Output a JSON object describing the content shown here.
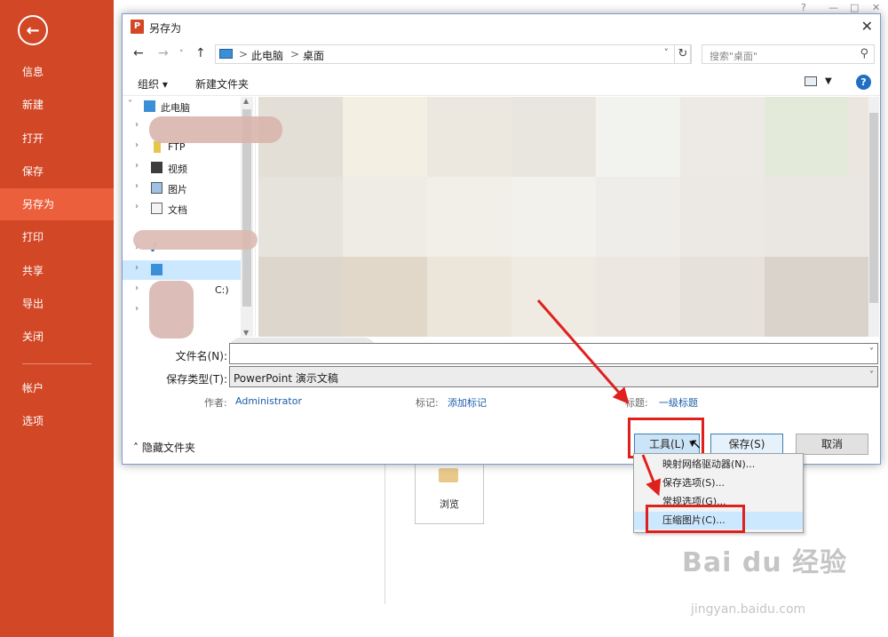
{
  "backstage": {
    "items": [
      {
        "label": "信息"
      },
      {
        "label": "新建"
      },
      {
        "label": "打开"
      },
      {
        "label": "保存"
      },
      {
        "label": "另存为"
      },
      {
        "label": "打印"
      },
      {
        "label": "共享"
      },
      {
        "label": "导出"
      },
      {
        "label": "关闭"
      },
      {
        "label": "帐户"
      },
      {
        "label": "选项"
      }
    ],
    "active_item": "另存为",
    "accent_color": "#d24726"
  },
  "background": {
    "browse_label": "浏览",
    "window_controls": [
      "?",
      "—",
      "□",
      "✕"
    ]
  },
  "dialog": {
    "title": "另存为",
    "close_glyph": "✕",
    "breadcrumb": [
      "此电脑",
      "桌面"
    ],
    "breadcrumb_sep": ">",
    "search_placeholder": "搜索\"桌面\"",
    "toolbar": {
      "organize": "组织 ▾",
      "new_folder": "新建文件夹"
    },
    "tree": [
      {
        "label": "此电脑",
        "icon": "pc-icon"
      },
      {
        "label": "",
        "icon": "folder-icon"
      },
      {
        "label": "FTP",
        "icon": "ftp-icon"
      },
      {
        "label": "视频",
        "icon": "video-icon"
      },
      {
        "label": "图片",
        "icon": "picture-icon"
      },
      {
        "label": "文档",
        "icon": "document-icon"
      },
      {
        "label": "",
        "icon": "download-icon"
      },
      {
        "label": "",
        "icon": "music-icon"
      },
      {
        "label": "",
        "icon": "desktop-icon"
      },
      {
        "label": "C:)",
        "icon": "drive-icon"
      },
      {
        "label": "",
        "icon": "drive-icon"
      }
    ],
    "file_name_label": "文件名(N):",
    "file_name_value": "",
    "save_type_label": "保存类型(T):",
    "save_type_value": "PowerPoint 演示文稿",
    "author_label": "作者:",
    "author_value": "Administrator",
    "tags_label": "标记:",
    "tags_value": "添加标记",
    "title_label": "标题:",
    "title_value": "一级标题",
    "hide_folders": "隐藏文件夹",
    "buttons": {
      "tools": "工具(L)",
      "save": "保存(S)",
      "cancel": "取消"
    }
  },
  "tools_menu": {
    "items": [
      {
        "label": "映射网络驱动器(N)..."
      },
      {
        "label": "保存选项(S)..."
      },
      {
        "label": "常规选项(G)..."
      },
      {
        "label": "压缩图片(C)..."
      }
    ],
    "highlighted": "压缩图片(C)..."
  },
  "annotations": {
    "highlight_color": "#e0201d"
  },
  "watermark": {
    "text": "Bai du 经验",
    "sub": "jingyan.baidu.com"
  }
}
